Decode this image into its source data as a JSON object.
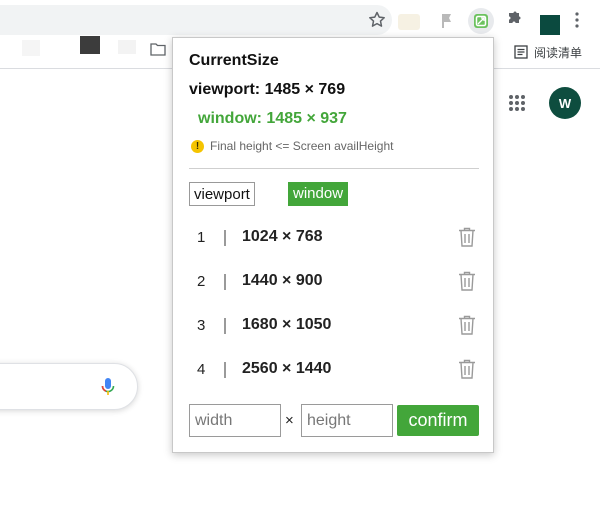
{
  "browser": {
    "bookmarks": {
      "reading_list_label": "阅读清单"
    },
    "account_avatar_letter": "W"
  },
  "popup": {
    "title": "CurrentSize",
    "viewport_line": "viewport: 1485 × 769",
    "window_line": "window: 1485 × 937",
    "warning_text": "Final height <= Screen availHeight",
    "modes": {
      "viewport_label": "viewport",
      "window_label": "window",
      "active": "window"
    },
    "presets": [
      {
        "index": "1",
        "size": "1024 × 768"
      },
      {
        "index": "2",
        "size": "1440 × 900"
      },
      {
        "index": "3",
        "size": "1680 × 1050"
      },
      {
        "index": "4",
        "size": "2560 × 1440"
      }
    ],
    "custom": {
      "width_placeholder": "width",
      "height_placeholder": "height",
      "times_symbol": "×",
      "confirm_label": "confirm"
    }
  },
  "colors": {
    "accent_green": "#43a63a",
    "warning_yellow": "#f5c400",
    "avatar_green": "#0e4d3f"
  }
}
